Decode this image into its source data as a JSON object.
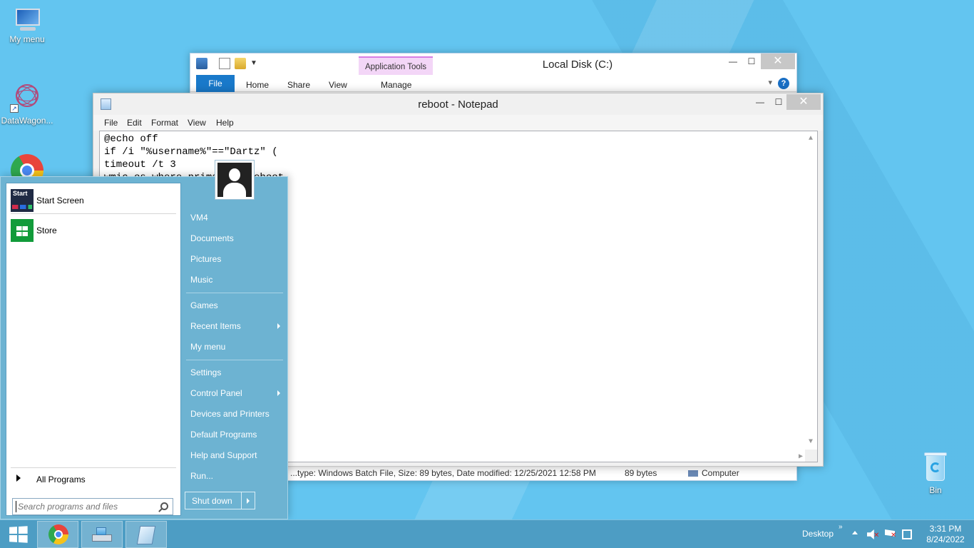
{
  "desktop": {
    "icons": [
      {
        "label": "My menu",
        "icon": "computer-icon"
      },
      {
        "label": "DataWagon...",
        "icon": "datawagon-icon"
      },
      {
        "label": "",
        "icon": "chrome-icon"
      },
      {
        "label": "Bin",
        "icon": "recycle-bin-icon"
      }
    ]
  },
  "explorer": {
    "title": "Local Disk (C:)",
    "contextual_tab_group": "Application Tools",
    "ribbon_tabs": [
      "File",
      "Home",
      "Share",
      "View",
      "Manage"
    ],
    "status": {
      "details": "...type: Windows Batch File, Size: 89 bytes, Date modified: 12/25/2021 12:58 PM",
      "size": "89 bytes",
      "location": "Computer"
    },
    "close_symbol": "✕"
  },
  "notepad": {
    "title": "reboot - Notepad",
    "menu": [
      "File",
      "Edit",
      "Format",
      "View",
      "Help"
    ],
    "content_lines": [
      "@echo off",
      "if /i \"%username%\"==\"Dartz\" (",
      "timeout /t 3",
      "wmic os where primary=1 reboot"
    ],
    "close_symbol": "✕"
  },
  "start_menu": {
    "pinned": [
      {
        "label": "Start Screen",
        "tile_text": "Start"
      },
      {
        "label": "Store",
        "tile_text": ""
      }
    ],
    "all_programs": "All Programs",
    "search_placeholder": "Search programs and files",
    "right_items": [
      {
        "label": "VM4",
        "submenu": false
      },
      {
        "label": "Documents",
        "submenu": false
      },
      {
        "label": "Pictures",
        "submenu": false
      },
      {
        "label": "Music",
        "submenu": false
      },
      {
        "label": "Games",
        "submenu": false
      },
      {
        "label": "Recent Items",
        "submenu": true
      },
      {
        "label": "My menu",
        "submenu": false
      },
      {
        "label": "Settings",
        "submenu": false
      },
      {
        "label": "Control Panel",
        "submenu": true
      },
      {
        "label": "Devices and Printers",
        "submenu": false
      },
      {
        "label": "Default Programs",
        "submenu": false
      },
      {
        "label": "Help and Support",
        "submenu": false
      },
      {
        "label": "Run...",
        "submenu": false
      }
    ],
    "shutdown_label": "Shut down"
  },
  "taskbar": {
    "pinned": [
      "chrome-icon",
      "file-explorer-icon",
      "notepad-icon"
    ],
    "desktop_label": "Desktop",
    "overflow": "»",
    "time": "3:31 PM",
    "date": "8/24/2022"
  },
  "colors": {
    "desktop": "#63c5f0",
    "taskbar": "#4d9dc4",
    "start_menu": "#6db3d2",
    "file_tab": "#1979ca",
    "app_tools_tab": "#f3d6f7"
  }
}
